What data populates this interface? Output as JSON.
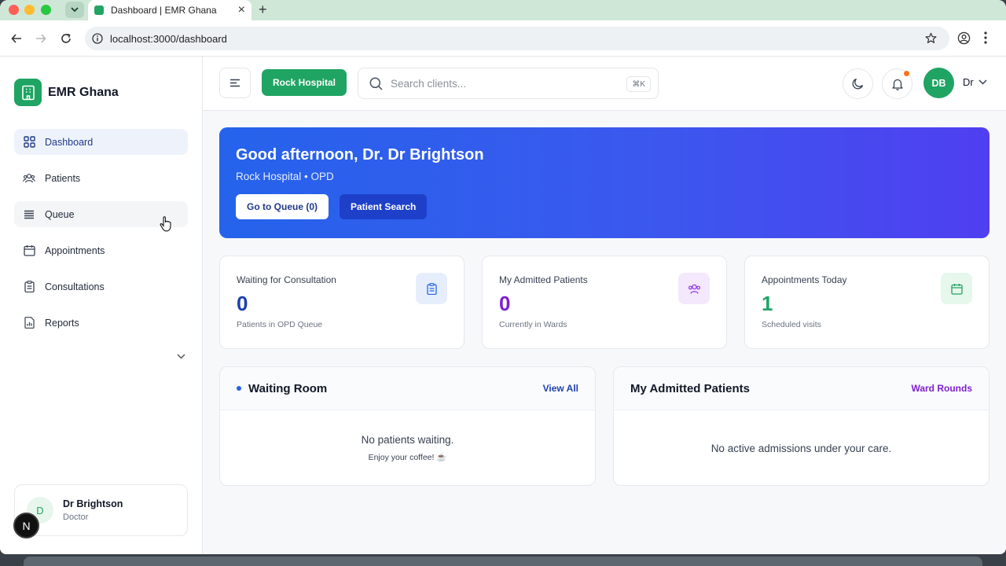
{
  "browser": {
    "tab_title": "Dashboard | EMR Ghana",
    "new_tab": "+",
    "close_tab": "×",
    "url": "localhost:3000/dashboard"
  },
  "sidebar": {
    "brand": "EMR Ghana",
    "items": [
      {
        "label": "Dashboard",
        "icon": "grid-icon"
      },
      {
        "label": "Patients",
        "icon": "users-icon"
      },
      {
        "label": "Queue",
        "icon": "list-icon"
      },
      {
        "label": "Appointments",
        "icon": "calendar-icon"
      },
      {
        "label": "Consultations",
        "icon": "clipboard-icon"
      },
      {
        "label": "Reports",
        "icon": "report-icon"
      }
    ],
    "user": {
      "initial": "D",
      "name": "Dr Brightson",
      "role": "Doctor"
    },
    "dev_badge": "N"
  },
  "topbar": {
    "hospital": "Rock Hospital",
    "search_placeholder": "Search clients...",
    "shortcut": "⌘K",
    "avatar_initials": "DB",
    "user_short": "Dr"
  },
  "hero": {
    "greeting": "Good afternoon, Dr. Dr Brightson",
    "subtitle": "Rock Hospital • OPD",
    "queue_button": "Go to Queue (0)",
    "search_button": "Patient Search"
  },
  "stats": [
    {
      "label": "Waiting for Consultation",
      "value": "0",
      "hint": "Patients in OPD Queue",
      "color": "#1e40af",
      "icon_bg": "#e6eefc",
      "icon_color": "#2563eb"
    },
    {
      "label": "My Admitted Patients",
      "value": "0",
      "hint": "Currently in Wards",
      "color": "#7e1fcf",
      "icon_bg": "#f3e8fc",
      "icon_color": "#9333ea"
    },
    {
      "label": "Appointments Today",
      "value": "1",
      "hint": "Scheduled visits",
      "color": "#1fa463",
      "icon_bg": "#e6f7ec",
      "icon_color": "#22a463"
    }
  ],
  "panels": {
    "waiting": {
      "title": "Waiting Room",
      "link": "View All",
      "empty": "No patients waiting.",
      "empty_sub": "Enjoy your coffee! ☕"
    },
    "admitted": {
      "title": "My Admitted Patients",
      "link": "Ward Rounds",
      "empty": "No active admissions under your care."
    }
  },
  "colors": {
    "brand": "#1fa463",
    "link_blue": "#1e40af",
    "link_purple": "#7e1fcf"
  }
}
